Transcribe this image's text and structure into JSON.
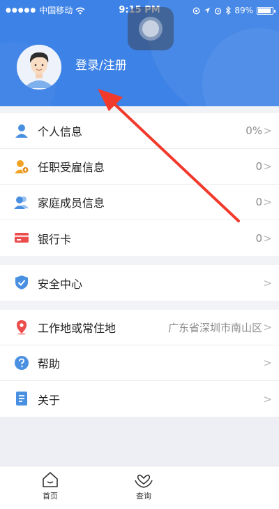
{
  "status_bar": {
    "carrier": "中国移动",
    "time": "9:15 PM",
    "battery": "89%"
  },
  "profile": {
    "login_label": "登录/注册"
  },
  "sections": {
    "info": [
      {
        "label": "个人信息",
        "value": "0%",
        "icon": "person-icon",
        "color": "#3d82e6"
      },
      {
        "label": "任职受雇信息",
        "value": "0",
        "icon": "employment-icon",
        "color": "#f0a323"
      },
      {
        "label": "家庭成员信息",
        "value": "0",
        "icon": "family-icon",
        "color": "#3d82e6"
      },
      {
        "label": "银行卡",
        "value": "0",
        "icon": "bank-card-icon",
        "color": "#ec4c4c"
      }
    ],
    "security": [
      {
        "label": "安全中心",
        "value": "",
        "icon": "shield-icon",
        "color": "#3d82e6"
      }
    ],
    "misc": [
      {
        "label": "工作地或常住地",
        "value": "广东省深圳市南山区",
        "icon": "location-pin-icon",
        "color": "#ec4c4c"
      },
      {
        "label": "帮助",
        "value": "",
        "icon": "help-icon",
        "color": "#3d82e6"
      },
      {
        "label": "关于",
        "value": "",
        "icon": "about-icon",
        "color": "#3d82e6"
      }
    ]
  },
  "tabbar": {
    "home": "首页",
    "query": "查询"
  },
  "colors": {
    "header_blue": "#3d82e6",
    "arrow_red": "#f23a2c"
  }
}
